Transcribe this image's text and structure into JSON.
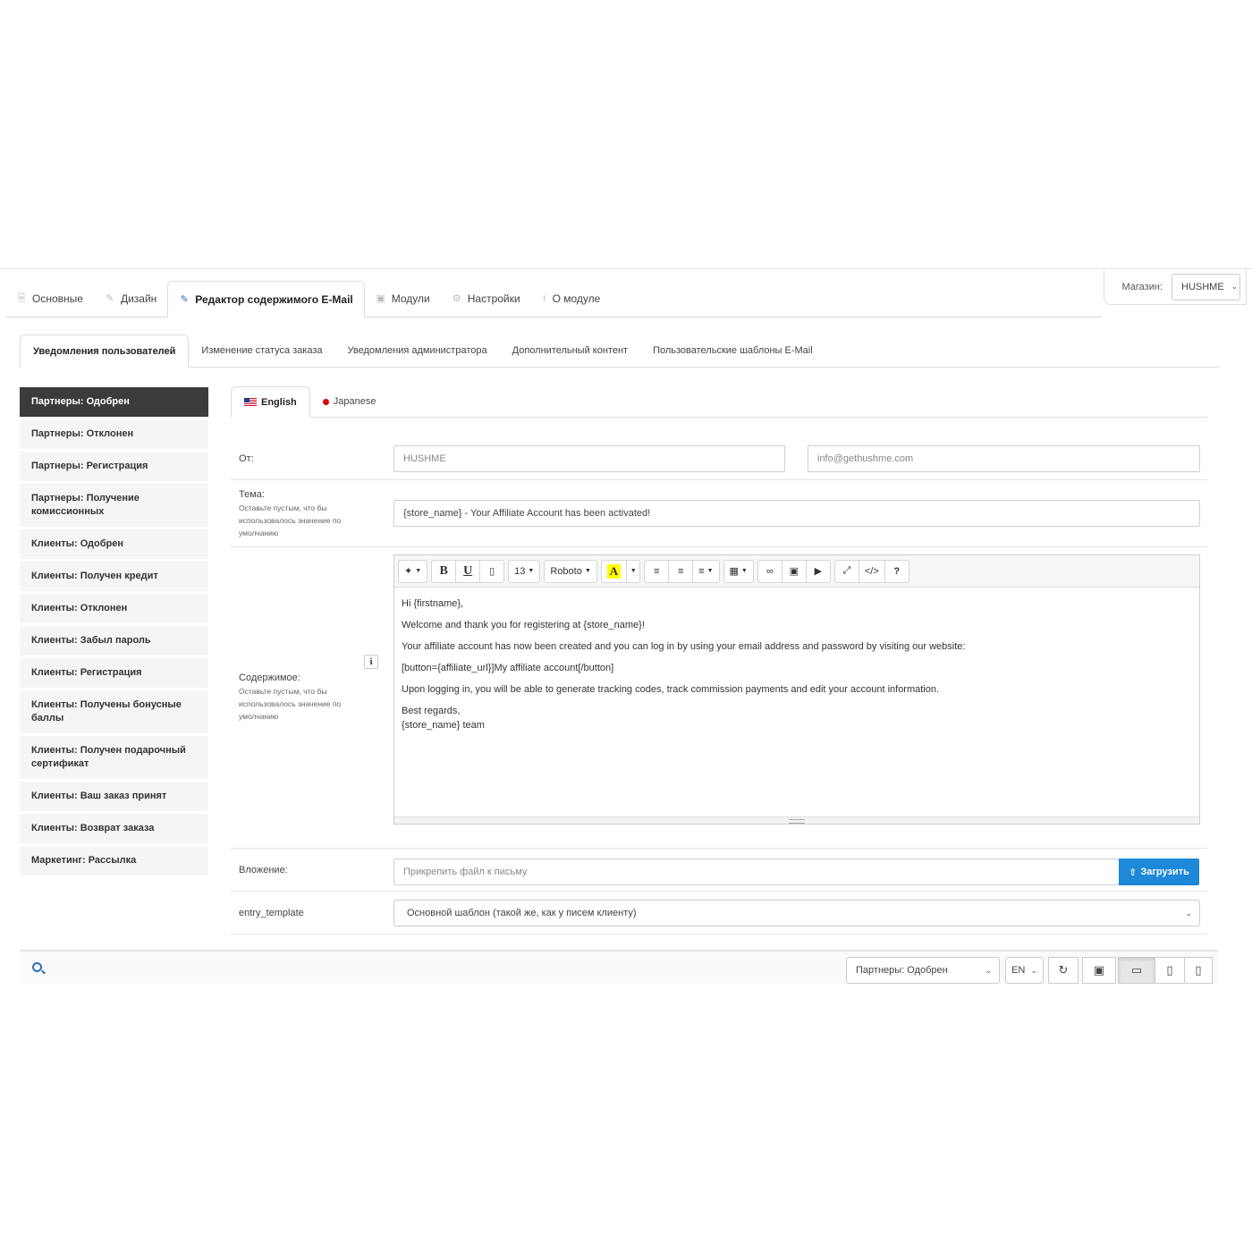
{
  "main_tabs": [
    {
      "label": "Основные",
      "icon": "document-icon"
    },
    {
      "label": "Дизайн",
      "icon": "brush-icon"
    },
    {
      "label": "Редактор содержимого E-Mail",
      "icon": "pencil-icon"
    },
    {
      "label": "Модули",
      "icon": "cube-icon"
    },
    {
      "label": "Настройки",
      "icon": "gear-icon"
    },
    {
      "label": "О модуле",
      "icon": "info-icon"
    }
  ],
  "store": {
    "label": "Магазин:",
    "value": "HUSHME"
  },
  "sub_tabs": [
    "Уведомления пользователей",
    "Изменение статуса заказа",
    "Уведомления администратора",
    "Дополнительный контент",
    "Пользовательские шаблоны E-Mail"
  ],
  "sidebar": [
    "Партнеры: Одобрен",
    "Партнеры: Отклонен",
    "Партнеры: Регистрация",
    "Партнеры: Получение комиссионных",
    "Клиенты: Одобрен",
    "Клиенты: Получен кредит",
    "Клиенты: Отклонен",
    "Клиенты: Забыл пароль",
    "Клиенты: Регистрация",
    "Клиенты: Получены бонусные баллы",
    "Клиенты: Получен подарочный сертификат",
    "Клиенты: Ваш заказ принят",
    "Клиенты: Возврат заказа",
    "Маркетинг: Рассылка"
  ],
  "lang_tabs": [
    "English",
    "Japanese"
  ],
  "form": {
    "from_label": "От:",
    "from_name": "HUSHME",
    "from_email": "info@gethushme.com",
    "subject_label": "Тема:",
    "subject_help": "Оставьте пустым, что бы использовалось значение по умолчанию",
    "subject_value": "{store_name} - Your Affiliate Account has been activated!",
    "content_label": "Содержимое:",
    "content_help": "Оставьте пустым, что бы использовалось значение по умолчанию",
    "attachment_label": "Вложение:",
    "attachment_placeholder": "Прикрепить файл к письму",
    "upload_label": "Загрузить",
    "template_label": "entry_template",
    "template_value": "Основной шаблон (такой же, как у писем клиенту)"
  },
  "toolbar": {
    "font_size": "13",
    "font_family": "Roboto"
  },
  "editor_body": {
    "line1": "Hi {firstname},",
    "line2": "Welcome and thank you for registering at {store_name}!",
    "line3": "Your affiliate account has now been created and you can log in by using your email address and password by visiting our website:",
    "line4": "[button={affiliate_url}]My affiliate account[/button]",
    "line5": "Upon logging in, you will be able to generate tracking codes, track commission payments and edit your account information.",
    "line6": "Best regards,",
    "line7": "{store_name} team"
  },
  "bottom_bar": {
    "template_select": "Партнеры: Одобрен",
    "lang_select": "EN"
  }
}
